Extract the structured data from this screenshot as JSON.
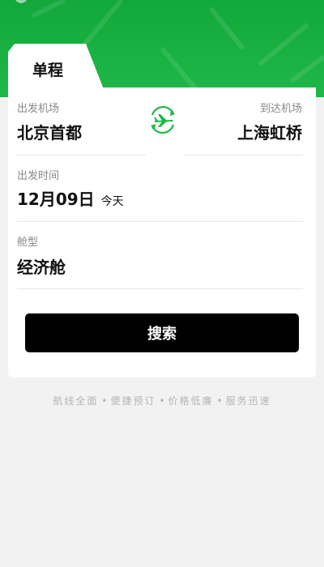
{
  "tab": {
    "label": "单程"
  },
  "departure": {
    "label": "出发机场",
    "value": "北京首都"
  },
  "arrival": {
    "label": "到达机场",
    "value": "上海虹桥"
  },
  "date": {
    "label": "出发时间",
    "value": "12月09日",
    "relative": "今天"
  },
  "cabin": {
    "label": "舱型",
    "value": "经济舱"
  },
  "search_button": {
    "label": "搜索"
  },
  "features": [
    "航线全面",
    "便捷预订",
    "价格低廉",
    "服务迅速"
  ],
  "colors": {
    "brand_green": "#1fb848",
    "button": "#000000"
  },
  "icons": {
    "swap": "plane-swap-icon"
  }
}
